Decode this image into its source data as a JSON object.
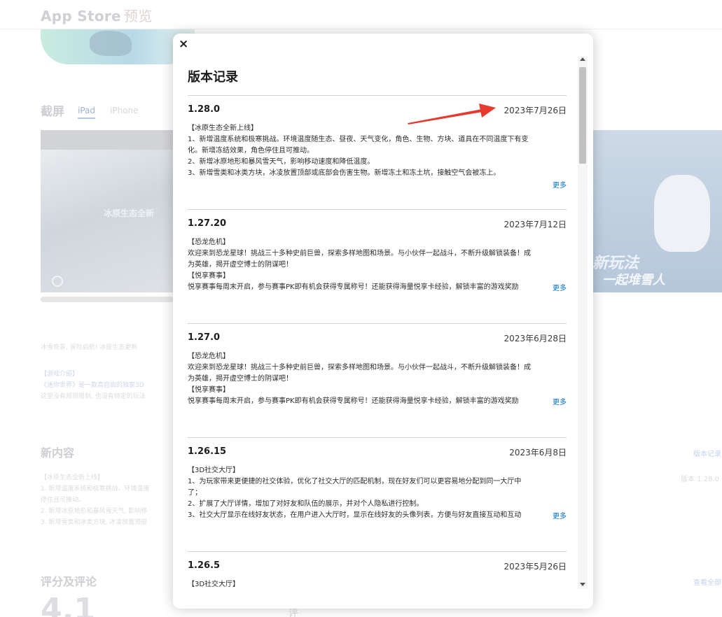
{
  "background": {
    "brand": "App Store",
    "brand_suffix": "预览",
    "screenshots_title": "截屏",
    "tabs": [
      "iPad",
      "iPhone"
    ],
    "shot_caption": "冰原生态全新",
    "shot_right_text_1": "新玩法",
    "shot_right_text_2": "一起堆雪人",
    "desc_lines": [
      "冰雪奇景, 冒险启航! 冰原生态更新",
      "【游戏介绍】",
      "《迷你世界》是一款高自由的独家3D",
      "这里没有规则限制, 也没有特定的玩法"
    ],
    "new_content_title": "新内容",
    "new_content_lines": [
      "【冰原生态全新上线】",
      "1. 新增温度系统和极寒挑战。环境温度",
      "停住且可推动。",
      "2. 新增冰原地形和暴风雪天气, 影响移",
      "3. 新增雪类和冰类方块, 冰凌放置顶部"
    ],
    "version_history_link": "版本记录",
    "version_label": "版本 1.28.0",
    "ratings_title": "评分及评论",
    "see_all": "查看全部",
    "rating_value": "4.1",
    "rating_mid": "评"
  },
  "modal": {
    "close_label": "×",
    "title": "版本记录",
    "more_label": "更多",
    "entries": [
      {
        "version": "1.28.0",
        "date": "2023年7月26日",
        "lines": [
          "【冰原生态全新上线】",
          "1、新增温度系统和极寒挑战。环境温度随生态、昼夜、天气变化，角色、生物、方块、道具在不同温度下有变",
          "化。新增冻结效果，角色停住且可推动。",
          "2、新增冰原地形和暴风雪天气，影响移动速度和降低温度。",
          "3、新增雪类和冰类方块，冰凌放置顶部或底部会伤害生物。新增冻土和冻土坑，接触空气会被冻上。"
        ]
      },
      {
        "version": "1.27.20",
        "date": "2023年7月12日",
        "lines": [
          "【恐龙危机】",
          "欢迎来到恐龙星球！挑战三十多种史前巨兽，探索多样地图和场景。与小伙伴一起战斗，不断升级解锁装备！成",
          "为英雄，揭开虚空博士的阴谋吧！",
          "【悦享赛事】",
          "悦享赛事每周末开启，参与赛事PK即有机会获得专属称号！还能获得海量悦享卡经验，解锁丰富的游戏奖励"
        ]
      },
      {
        "version": "1.27.0",
        "date": "2023年6月28日",
        "lines": [
          "【恐龙危机】",
          "欢迎来到恐龙星球！挑战三十多种史前巨兽，探索多样地图和场景。与小伙伴一起战斗，不断升级解锁装备！成",
          "为英雄，揭开虚空博士的阴谋吧！",
          "【悦享赛事】",
          "悦享赛事每周末开启，参与赛事PK即有机会获得专属称号！还能获得海量悦享卡经验，解锁丰富的游戏奖励"
        ]
      },
      {
        "version": "1.26.15",
        "date": "2023年6月8日",
        "lines": [
          "【3D社交大厅】",
          "1、为玩家带来更便捷的社交体验，优化了社交大厅的匹配机制，现在好友们可以更容易地分配到同一大厅中",
          "了；",
          "2、扩展了大厅详情，增加了对好友和队伍的展示，并对个人隐私进行控制。",
          "3、社交大厅显示在线好友状态，在用户进入大厅时，显示在线好友的头像列表，方便与好友直接互动和互动"
        ]
      },
      {
        "version": "1.26.5",
        "date": "2023年5月26日",
        "lines": [
          "【3D社交大厅】"
        ]
      }
    ]
  }
}
